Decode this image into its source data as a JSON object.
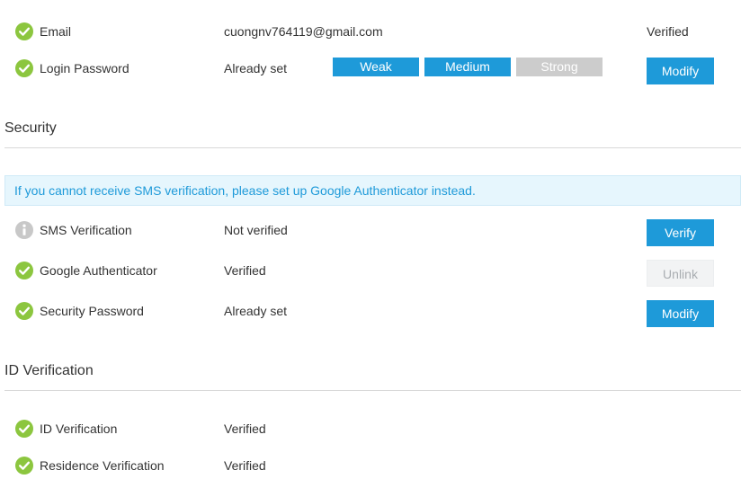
{
  "colors": {
    "accent": "#1e9ad9",
    "check": "#8cc63f",
    "info": "#c8c8c8"
  },
  "account": {
    "email": {
      "icon": "check-circle-icon",
      "label": "Email",
      "value": "cuongnv764119@gmail.com",
      "status": "Verified"
    },
    "login_password": {
      "icon": "check-circle-icon",
      "label": "Login Password",
      "value": "Already set",
      "strength": {
        "weak": "Weak",
        "medium": "Medium",
        "strong": "Strong",
        "level": "medium"
      },
      "button": "Modify"
    }
  },
  "security": {
    "title": "Security",
    "notice": "If you cannot receive SMS verification, please set up Google Authenticator instead.",
    "items": [
      {
        "icon": "info-circle-icon",
        "label": "SMS Verification",
        "value": "Not verified",
        "button": "Verify"
      },
      {
        "icon": "check-circle-icon",
        "label": "Google Authenticator",
        "value": "Verified",
        "button": "Unlink"
      },
      {
        "icon": "check-circle-icon",
        "label": "Security Password",
        "value": "Already set",
        "button": "Modify"
      }
    ]
  },
  "id_verification": {
    "title": "ID Verification",
    "items": [
      {
        "icon": "check-circle-icon",
        "label": "ID Verification",
        "value": "Verified"
      },
      {
        "icon": "check-circle-icon",
        "label": "Residence Verification",
        "value": "Verified"
      }
    ]
  }
}
